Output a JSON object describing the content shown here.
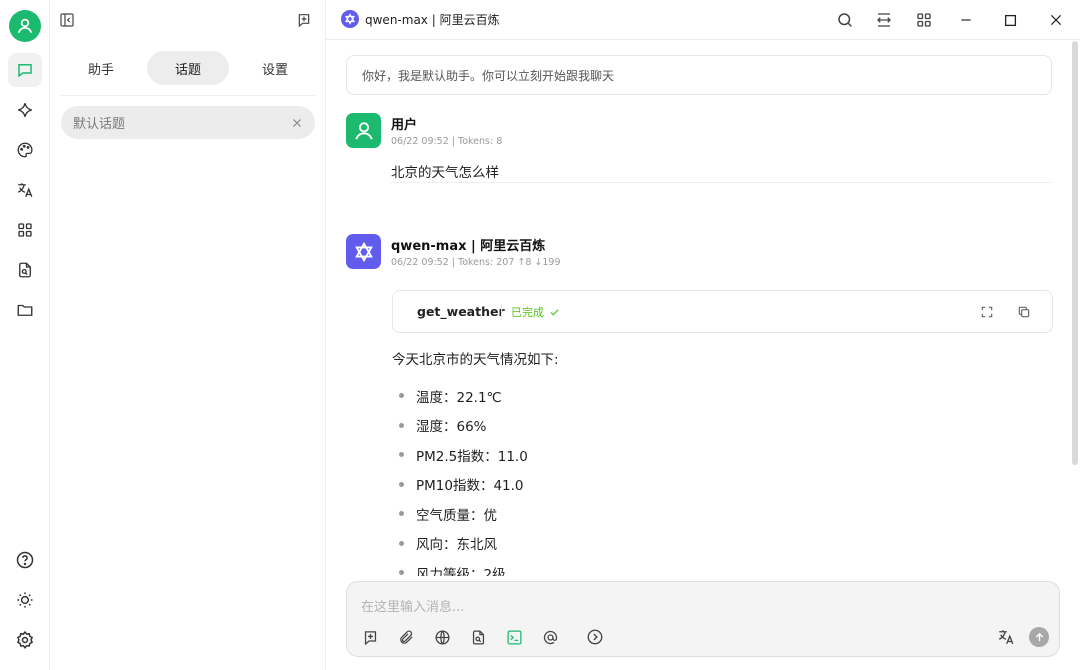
{
  "panel": {
    "tabs": [
      {
        "label": "助手",
        "active": false
      },
      {
        "label": "话题",
        "active": true
      },
      {
        "label": "设置",
        "active": false
      }
    ],
    "topic": "默认话题"
  },
  "topbar": {
    "model_name": "qwen-max | 阿里云百炼"
  },
  "chat": {
    "greeting": "你好，我是默认助手。你可以立刻开始跟我聊天",
    "user_msg": {
      "name": "用户",
      "meta": "06/22 09:52  |  Tokens: 8",
      "text": "北京的天气怎么样"
    },
    "ai_msg": {
      "name": "qwen-max | 阿里云百炼",
      "meta": "06/22 09:52  |  Tokens: 207 ↑8 ↓199",
      "tool": {
        "name": "get_weather",
        "status": "已完成"
      },
      "intro": "今天北京市的天气情况如下:",
      "items": [
        "温度：22.1℃",
        "湿度：66%",
        "PM2.5指数：11.0",
        "PM10指数：41.0",
        "空气质量：优",
        "风向：东北风",
        "风力等级：2级"
      ]
    }
  },
  "input": {
    "placeholder": "在这里输入消息..."
  },
  "colors": {
    "accent_green": "#1cba6f",
    "model_purple": "#615ced",
    "status_green": "#52c41a"
  }
}
